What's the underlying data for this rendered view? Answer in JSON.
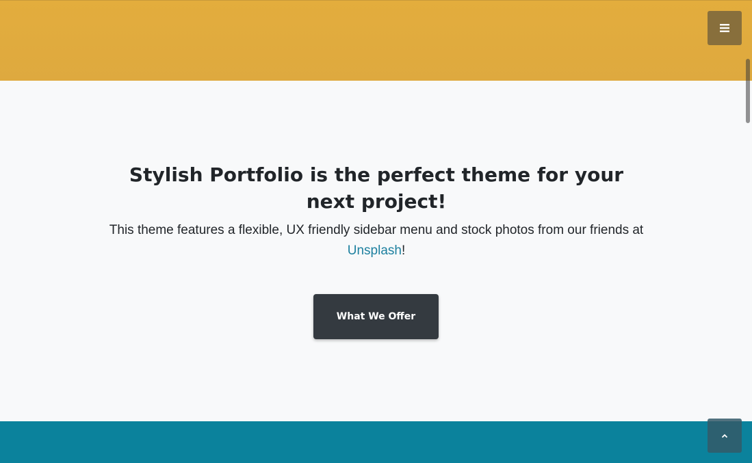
{
  "menu": {
    "icon": "hamburger-icon"
  },
  "about": {
    "heading": "Stylish Portfolio is the perfect theme for your next project!",
    "lead_before": "This theme features a flexible, UX friendly sidebar menu and stock photos from our friends at ",
    "link_text": "Unsplash",
    "lead_after": "!",
    "button_label": "What We Offer"
  },
  "scroll_top": {
    "icon": "chevron-up-icon"
  },
  "colors": {
    "hero": "#e0ab3e",
    "services": "#0b829c",
    "button": "#343a40",
    "link": "#1d809f"
  }
}
